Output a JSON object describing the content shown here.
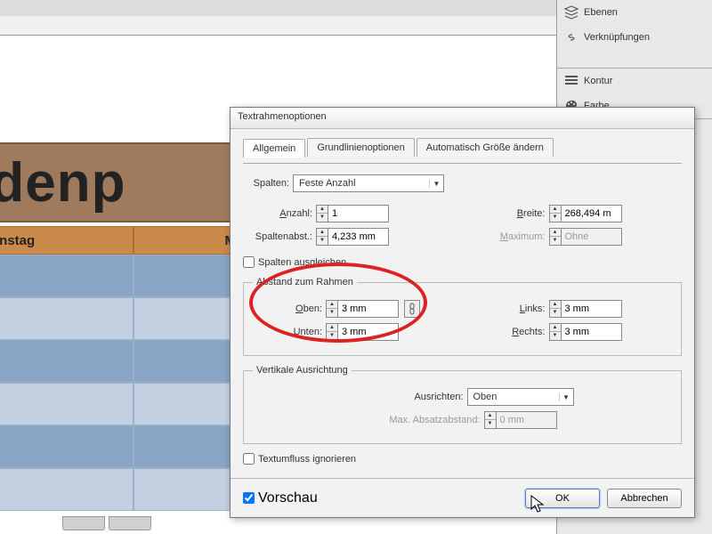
{
  "panels": {
    "ebenen": "Ebenen",
    "verknuepfungen": "Verknüpfungen",
    "kontur": "Kontur",
    "farbe": "Farbe"
  },
  "doc": {
    "title_fragment": "tundenp",
    "day1": "enstag",
    "day2": "Mittwoch"
  },
  "dialog": {
    "title": "Textrahmenoptionen",
    "tabs": {
      "allgemein": "Allgemein",
      "grundlinien": "Grundlinienoptionen",
      "auto": "Automatisch Größe ändern"
    },
    "spalten_label": "Spalten:",
    "spalten_value": "Feste Anzahl",
    "anzahl_label": "Anzahl:",
    "anzahl_value": "1",
    "breite_label": "Breite:",
    "breite_value": "268,494 m",
    "spaltenabst_label": "Spaltenabst.:",
    "spaltenabst_value": "4,233 mm",
    "maximum_label": "Maximum:",
    "maximum_value": "Ohne",
    "ausgleichen": "Spalten ausgleichen",
    "abstand_legend": "Abstand zum Rahmen",
    "oben_label": "Oben:",
    "oben_value": "3 mm",
    "unten_label": "Unten:",
    "unten_value": "3 mm",
    "links_label": "Links:",
    "links_value": "3 mm",
    "rechts_label": "Rechts:",
    "rechts_value": "3 mm",
    "vert_legend": "Vertikale Ausrichtung",
    "ausrichten_label": "Ausrichten:",
    "ausrichten_value": "Oben",
    "maxabs_label": "Max. Absatzabstand:",
    "maxabs_value": "0 mm",
    "textumfluss": "Textumfluss ignorieren",
    "vorschau": "Vorschau",
    "ok": "OK",
    "abbrechen": "Abbrechen"
  }
}
